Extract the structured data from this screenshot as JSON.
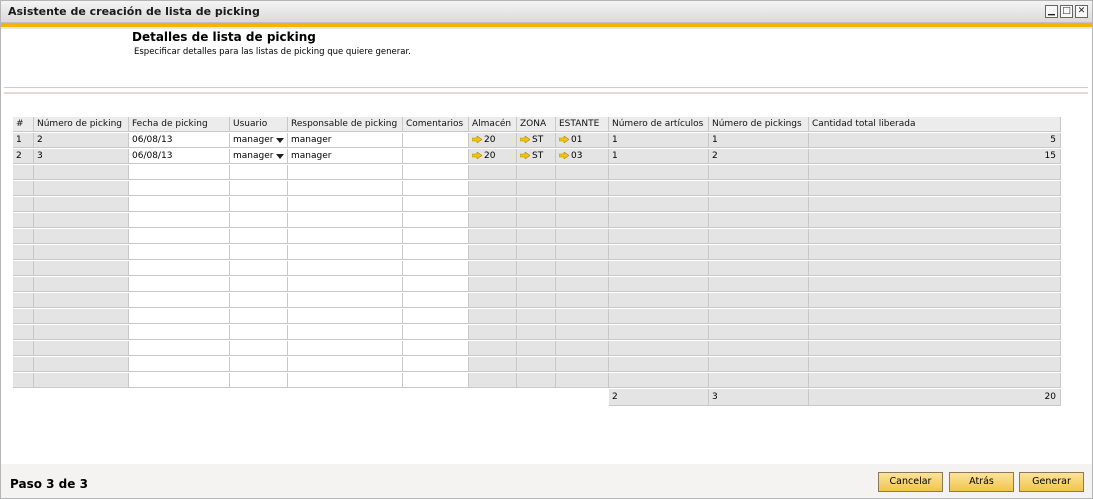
{
  "window": {
    "title": "Asistente de creación de lista de picking",
    "minimize_glyph": "▁",
    "maximize_glyph": "□",
    "close_glyph": "✕"
  },
  "header": {
    "title": "Detalles de lista de picking",
    "subtitle": "Especificar detalles para las listas de picking que quiere generar."
  },
  "table": {
    "columns": [
      "#",
      "Número de picking",
      "Fecha de picking",
      "Usuario",
      "Responsable de picking",
      "Comentarios",
      "Almacén",
      "ZONA",
      "ESTANTE",
      "Número de artículos",
      "Número de pickings",
      "Cantidad total liberada"
    ],
    "rows": [
      {
        "idx": "1",
        "picking_no": "2",
        "fecha": "06/08/13",
        "usuario": "manager",
        "responsable": "manager",
        "comentarios": "",
        "almacen": "20",
        "zona": "ST",
        "estante": "01",
        "num_articulos": "1",
        "num_pickings": "1",
        "cantidad": "5"
      },
      {
        "idx": "2",
        "picking_no": "3",
        "fecha": "06/08/13",
        "usuario": "manager",
        "responsable": "manager",
        "comentarios": "",
        "almacen": "20",
        "zona": "ST",
        "estante": "03",
        "num_articulos": "1",
        "num_pickings": "2",
        "cantidad": "15"
      }
    ],
    "empty_row_count": 14,
    "totals": {
      "num_articulos": "2",
      "num_pickings": "3",
      "cantidad": "20"
    },
    "link_arrow_color": "#f2c21c"
  },
  "footer": {
    "step": "Paso 3 de 3",
    "cancel_label": "Cancelar",
    "back_label": "Atrás",
    "generate_label": "Generar"
  },
  "colors": {
    "accent": "#f2b600",
    "button": "#f2c44b"
  }
}
